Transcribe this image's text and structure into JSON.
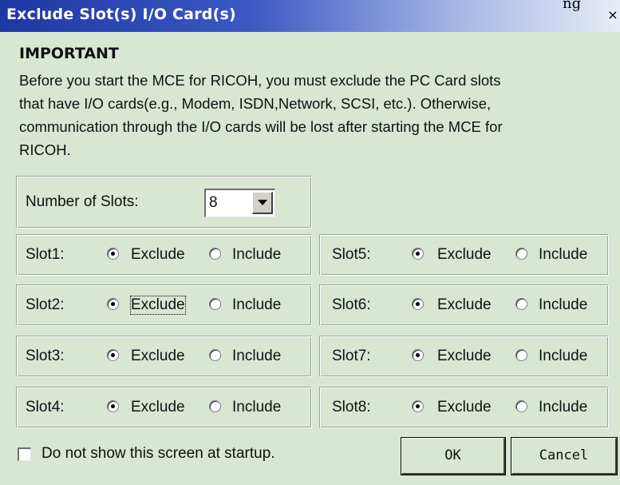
{
  "window": {
    "title": "Exclude Slot(s) I/O Card(s)",
    "clipped_text": "ng",
    "close_glyph": "×"
  },
  "notice": {
    "heading": "IMPORTANT",
    "lines": [
      "Before you start the MCE for RICOH, you must exclude the PC Card slots",
      "that have I/O cards(e.g., Modem, ISDN,Network, SCSI, etc.). Otherwise,",
      "communication through the I/O cards will be lost after starting the MCE for",
      "RICOH."
    ]
  },
  "num_slots": {
    "label": "Number of Slots:",
    "value": "8"
  },
  "slots": [
    {
      "label": "Slot1:",
      "exclude_label": "Exclude",
      "include_label": "Include",
      "selected": "exclude"
    },
    {
      "label": "Slot2:",
      "exclude_label": "Exclude",
      "include_label": "Include",
      "selected": "exclude"
    },
    {
      "label": "Slot3:",
      "exclude_label": "Exclude",
      "include_label": "Include",
      "selected": "exclude"
    },
    {
      "label": "Slot4:",
      "exclude_label": "Exclude",
      "include_label": "Include",
      "selected": "exclude"
    },
    {
      "label": "Slot5:",
      "exclude_label": "Exclude",
      "include_label": "Include",
      "selected": "exclude"
    },
    {
      "label": "Slot6:",
      "exclude_label": "Exclude",
      "include_label": "Include",
      "selected": "exclude"
    },
    {
      "label": "Slot7:",
      "exclude_label": "Exclude",
      "include_label": "Include",
      "selected": "exclude"
    },
    {
      "label": "Slot8:",
      "exclude_label": "Exclude",
      "include_label": "Include",
      "selected": "exclude"
    }
  ],
  "footer": {
    "checkbox_label": "Do not show this screen at startup.",
    "checkbox_checked": false,
    "ok_label": "OK",
    "cancel_label": "Cancel"
  },
  "colors": {
    "dialog_bg": "#d9e6d2",
    "titlebar_start": "#1e38a3",
    "titlebar_end": "#e8ecf6"
  }
}
